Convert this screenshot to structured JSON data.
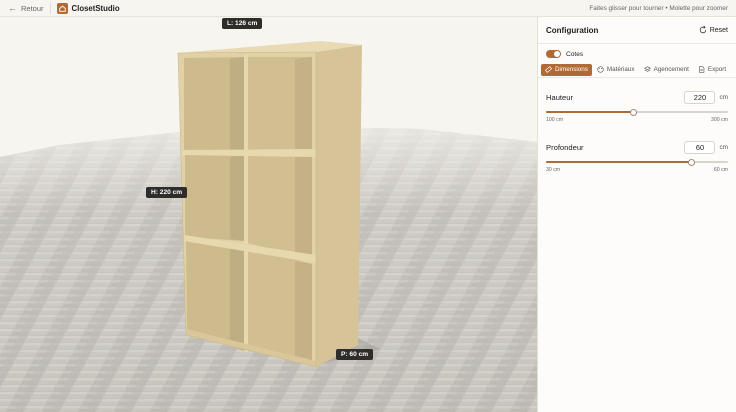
{
  "topbar": {
    "back_label": "Retour",
    "brand": "ClosetStudio",
    "hint": "Faites glisser pour tourner • Molette pour zoomer"
  },
  "viewport": {
    "labels": {
      "width": "L: 126 cm",
      "height": "H: 220 cm",
      "depth": "P: 60 cm"
    },
    "colors": {
      "wood": "#e2d1a6",
      "accent": "#b06a35"
    }
  },
  "panel": {
    "title": "Configuration",
    "reset_label": "Reset",
    "toggle_label": "Cotes",
    "toggle_on": true,
    "tabs": [
      {
        "label": "Dimensions",
        "icon": "ruler-icon",
        "active": true
      },
      {
        "label": "Matériaux",
        "icon": "palette-icon",
        "active": false
      },
      {
        "label": "Agencement",
        "icon": "layers-icon",
        "active": false
      },
      {
        "label": "Export",
        "icon": "document-icon",
        "active": false
      }
    ],
    "fields": [
      {
        "label": "Hauteur",
        "value": "220",
        "unit": "cm",
        "min_label": "100 cm",
        "max_label": "300 cm",
        "min": 100,
        "max": 300,
        "current": 220
      },
      {
        "label": "Profondeur",
        "value": "60",
        "unit": "cm",
        "min_label": "30 cm",
        "max_label": "60 cm",
        "min": 30,
        "max": 60,
        "current": 60
      }
    ]
  }
}
